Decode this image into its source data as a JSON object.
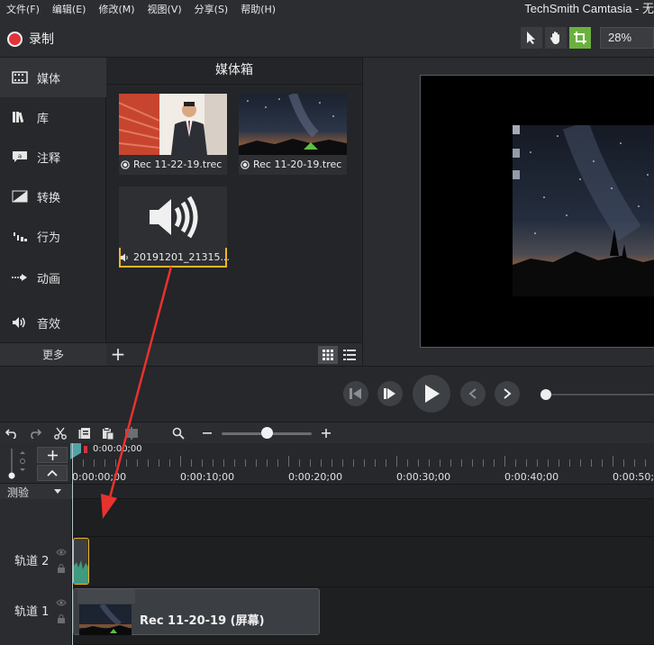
{
  "menu": {
    "items": [
      "文件(F)",
      "编辑(E)",
      "修改(M)",
      "视图(V)",
      "分享(S)",
      "帮助(H)"
    ],
    "app_title": "TechSmith Camtasia - 无"
  },
  "toolbar": {
    "record_label": "录制",
    "zoom_value": "28%"
  },
  "nav": {
    "items": [
      {
        "label": "媒体",
        "icon": "film-strip-icon"
      },
      {
        "label": "库",
        "icon": "library-icon"
      },
      {
        "label": "注释",
        "icon": "annotation-icon"
      },
      {
        "label": "转换",
        "icon": "transition-icon"
      },
      {
        "label": "行为",
        "icon": "behavior-icon"
      },
      {
        "label": "动画",
        "icon": "animation-icon"
      },
      {
        "label": "音效",
        "icon": "audio-effect-icon"
      }
    ],
    "more_label": "更多"
  },
  "bin": {
    "title": "媒体箱",
    "items": [
      {
        "name": "Rec 11-22-19.trec",
        "type": "video"
      },
      {
        "name": "Rec 11-20-19.trec",
        "type": "video"
      },
      {
        "name": "20191201_21315...",
        "type": "audio"
      }
    ]
  },
  "timeline": {
    "playhead_time": "0:00:00;00",
    "ruler_labels": [
      "0:00:00;00",
      "0:00:10;00",
      "0:00:20;00",
      "0:00:30;00",
      "0:00:40;00",
      "0:00:50;00"
    ],
    "marker_label": "测验",
    "tracks": [
      {
        "name": "轨道 2"
      },
      {
        "name": "轨道 1",
        "clip_label": "Rec 11-20-19 (屏幕)"
      }
    ]
  },
  "colors": {
    "accent": "#6bb03f",
    "selection": "#f0b429",
    "record": "#e3323a",
    "arrow": "#e8322e"
  }
}
